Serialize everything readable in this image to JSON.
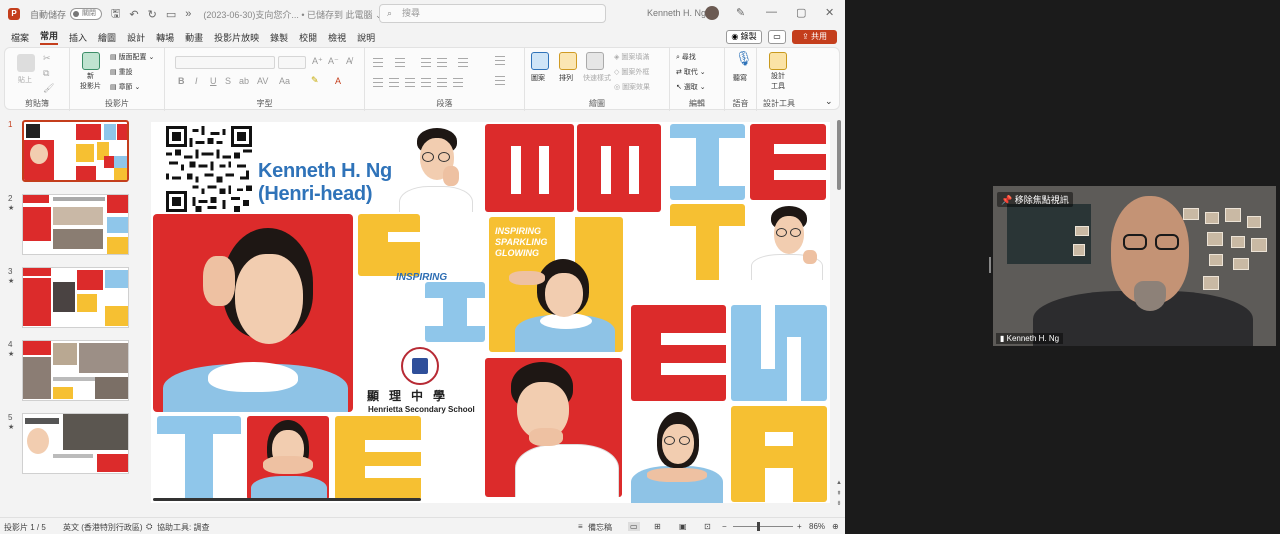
{
  "titlebar": {
    "autosave_label": "自動儲存",
    "autosave_state": "關閉",
    "doc_title": "(2023-06-30)支向您介... • 已儲存到 此電腦 ⌄",
    "search_placeholder": "搜尋",
    "user_name": "Kenneth H. Ng"
  },
  "tabs": [
    "檔案",
    "常用",
    "插入",
    "繪圖",
    "設計",
    "轉場",
    "動畫",
    "投影片放映",
    "錄製",
    "校閱",
    "檢視",
    "說明"
  ],
  "tab_actions": {
    "record": "錄製",
    "share": "共用"
  },
  "ribbon": {
    "groups": [
      "剪貼簿",
      "投影片",
      "字型",
      "段落",
      "繪圖",
      "編輯",
      "語音",
      "設計工具"
    ],
    "clipboard": {
      "paste": "貼上"
    },
    "slides": {
      "new_slide": "新\n投影片",
      "layout": "版面配置",
      "reset": "重設",
      "section": "章節"
    },
    "drawing": {
      "shapes": "圖案",
      "arrange": "排列",
      "quick_styles": "快速樣式",
      "fill": "圖案填滿",
      "outline": "圖案外框",
      "effects": "圖案效果"
    },
    "editing": {
      "find": "尋找",
      "replace": "取代",
      "select": "選取"
    },
    "voice": {
      "dictate": "聽寫"
    },
    "designer": {
      "designer": "設計\n工具"
    }
  },
  "thumbnails": [
    {
      "num": "1",
      "star": ""
    },
    {
      "num": "2",
      "star": "★"
    },
    {
      "num": "3",
      "star": "★"
    },
    {
      "num": "4",
      "star": "★"
    },
    {
      "num": "5",
      "star": "★"
    }
  ],
  "slide": {
    "name_line1": "Kenneth H. Ng",
    "name_line2": "(Henri-head)",
    "inspiring": "INSPIRING",
    "isg_1": "INSPIRING",
    "isg_2": "SPARKLING",
    "isg_3": "GLOWING",
    "school_zh": "顯理中學",
    "school_en": "Henrietta Secondary School",
    "colors": {
      "red": "#dc2b2b",
      "blue": "#8fc6ea",
      "yellow": "#f6c032"
    }
  },
  "statusbar": {
    "slide_counter": "投影片 1 / 5",
    "language": "英文 (香港特別行政區)",
    "accessibility": "協助工具: 調查",
    "notes": "備忘稿",
    "zoom": "86%"
  },
  "video": {
    "pin_label": "移除焦點視訊",
    "participant_name": "Kenneth H. Ng"
  }
}
